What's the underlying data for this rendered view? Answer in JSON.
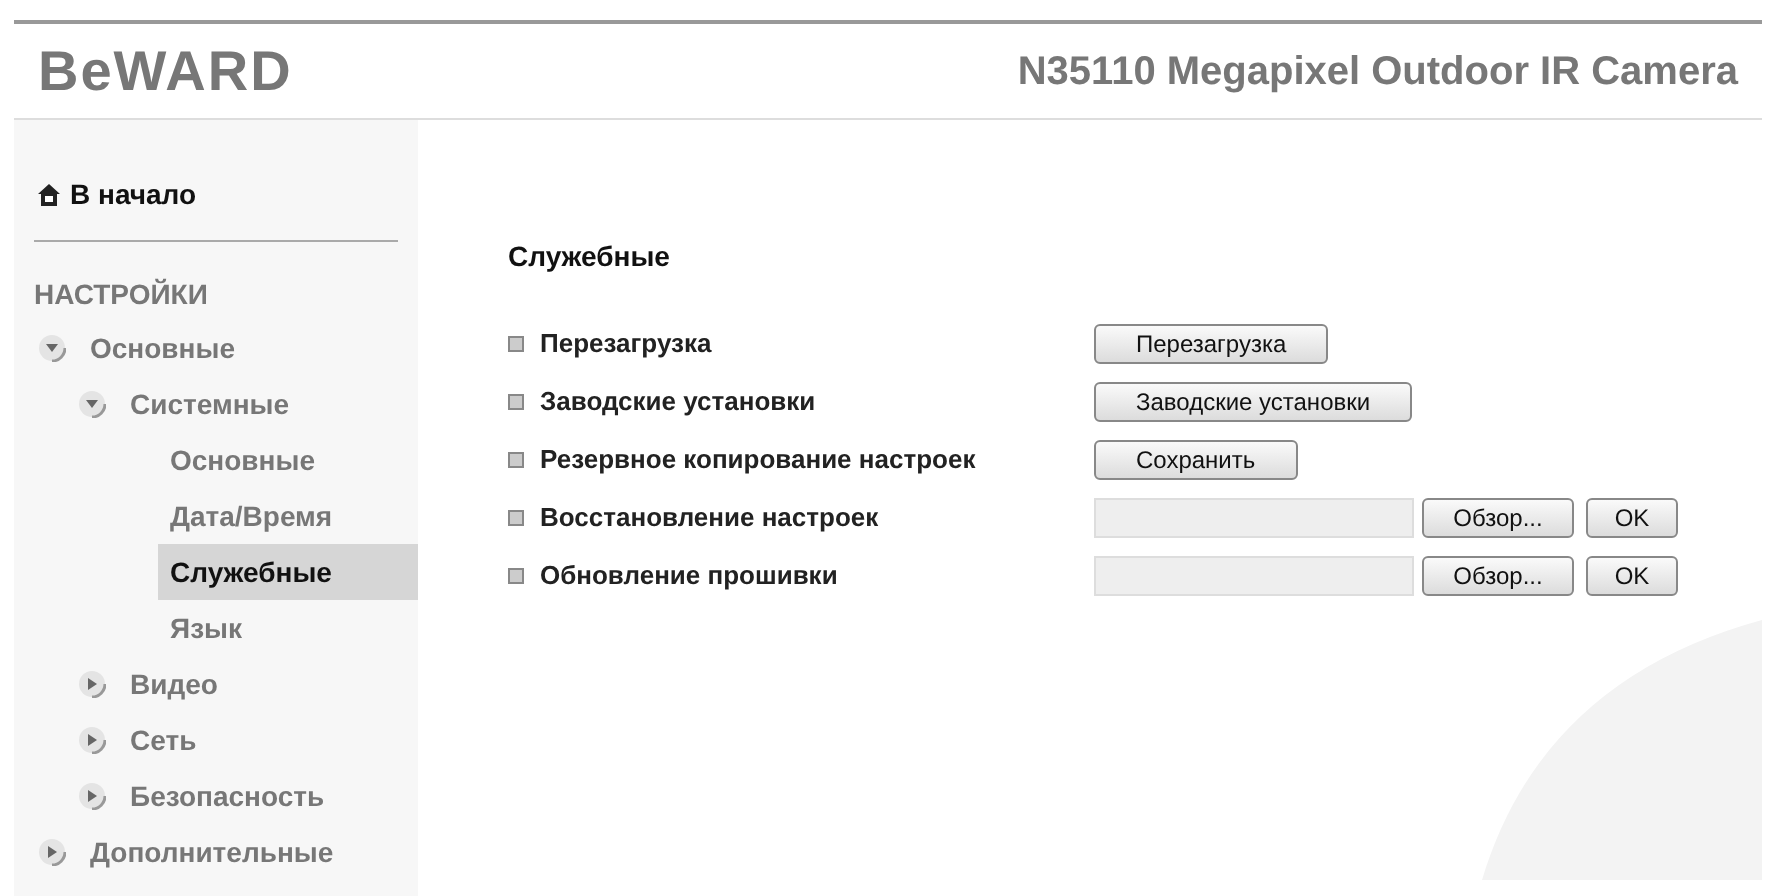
{
  "header": {
    "logo": "BeWARD",
    "title": "N35110 Megapixel Outdoor IR Camera"
  },
  "sidebar": {
    "home": "В начало",
    "section": "НАСТРОЙКИ",
    "items": [
      {
        "label": "Основные",
        "expanded": true,
        "children": [
          {
            "label": "Системные",
            "expanded": true,
            "children": [
              {
                "label": "Основные",
                "selected": false
              },
              {
                "label": "Дата/Время",
                "selected": false
              },
              {
                "label": "Служебные",
                "selected": true
              },
              {
                "label": "Язык",
                "selected": false
              }
            ]
          },
          {
            "label": "Видео",
            "expanded": false
          },
          {
            "label": "Сеть",
            "expanded": false
          },
          {
            "label": "Безопасность",
            "expanded": false
          }
        ]
      },
      {
        "label": "Дополнительные",
        "expanded": false
      }
    ]
  },
  "main": {
    "title": "Служебные",
    "rows": [
      {
        "kind": "button",
        "label": "Перезагрузка",
        "button": "Перезагрузка"
      },
      {
        "kind": "button",
        "label": "Заводские установки",
        "button": "Заводские установки"
      },
      {
        "kind": "button",
        "label": "Резервное копирование настроек",
        "button": "Сохранить"
      },
      {
        "kind": "file",
        "label": "Восстановление настроек",
        "browse": "Обзор...",
        "ok": "OK"
      },
      {
        "kind": "file",
        "label": "Обновление прошивки",
        "browse": "Обзор...",
        "ok": "OK"
      }
    ]
  }
}
